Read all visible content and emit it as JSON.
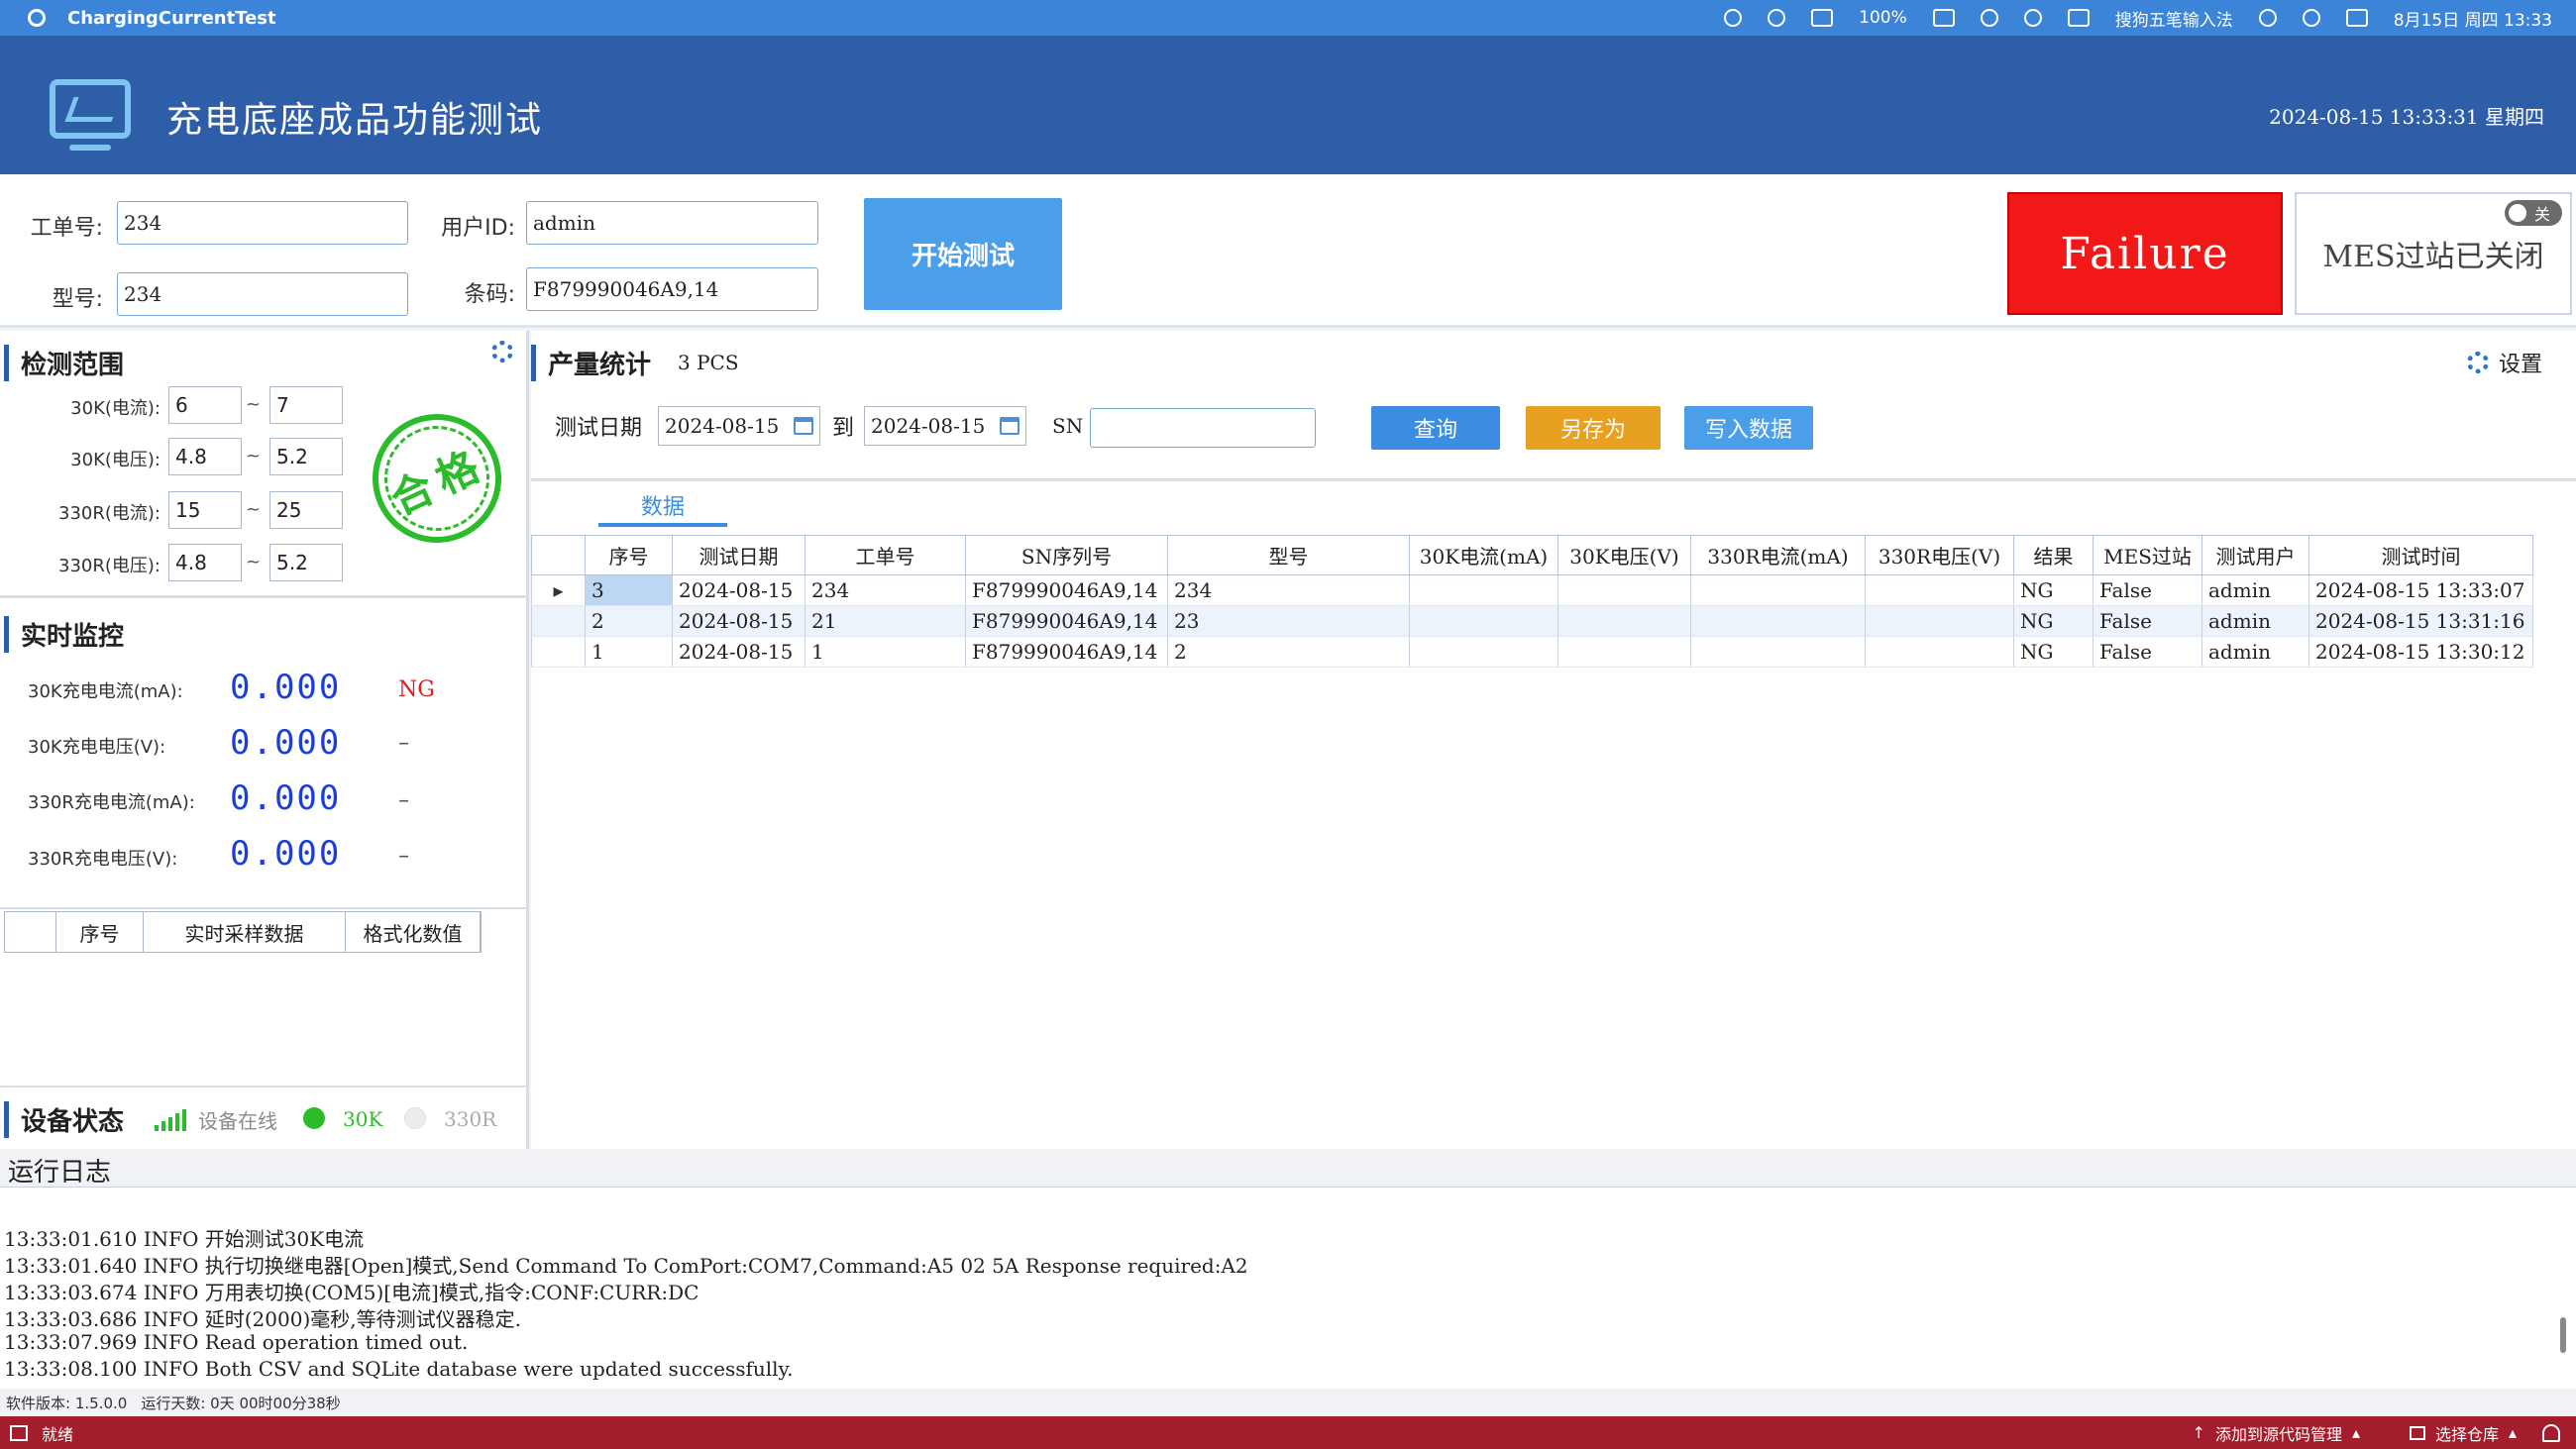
{
  "os": {
    "app_name": "ChargingCurrentTest",
    "battery": "100%",
    "ime": "搜狗五笔输入法",
    "clock": "8月15日 周四 13:33"
  },
  "header": {
    "title": "充电底座成品功能测试",
    "datetime": "2024-08-15 13:33:31 星期四"
  },
  "form": {
    "order_label": "工单号:",
    "order_value": "234",
    "user_label": "用户ID:",
    "user_value": "admin",
    "model_label": "型号:",
    "model_value": "234",
    "barcode_label": "条码:",
    "barcode_value": "F879990046A9,14",
    "start_button": "开始测试",
    "result": "Failure",
    "mes_status": "MES过站已关闭",
    "mes_toggle": "关"
  },
  "range": {
    "title": "检测范围",
    "rows": [
      {
        "label": "30K(电流):",
        "min": "6",
        "max": "7"
      },
      {
        "label": "30K(电压):",
        "min": "4.8",
        "max": "5.2"
      },
      {
        "label": "330R(电流):",
        "min": "15",
        "max": "25"
      },
      {
        "label": "330R(电压):",
        "min": "4.8",
        "max": "5.2"
      }
    ],
    "tilde": "~",
    "stamp_text": "合格"
  },
  "monitor": {
    "title": "实时监控",
    "rows": [
      {
        "label": "30K充电电流(mA):",
        "value": "0.000",
        "status": "NG"
      },
      {
        "label": "30K充电电压(V):",
        "value": "0.000",
        "status": "–"
      },
      {
        "label": "330R充电电流(mA):",
        "value": "0.000",
        "status": "–"
      },
      {
        "label": "330R充电电压(V):",
        "value": "0.000",
        "status": "–"
      }
    ]
  },
  "sample_table": {
    "columns": [
      "序号",
      "实时采样数据",
      "格式化数值"
    ]
  },
  "device": {
    "title": "设备状态",
    "online": "设备在线",
    "dev1": "30K",
    "dev2": "330R",
    "dev1_color": "#2bbb2b",
    "dev2_color": "#e4e4e4"
  },
  "stats": {
    "title": "产量统计",
    "count": "3 PCS",
    "settings": "设置",
    "date_label": "测试日期",
    "date_from": "2024-08-15",
    "to_label": "到",
    "date_to": "2024-08-15",
    "sn_label": "SN",
    "sn_value": "",
    "query_button": "查询",
    "saveas_button": "另存为",
    "write_button": "写入数据",
    "tab": "数据"
  },
  "grid": {
    "columns": [
      "序号",
      "测试日期",
      "工单号",
      "SN序列号",
      "型号",
      "30K电流(mA)",
      "30K电压(V)",
      "330R电流(mA)",
      "330R电压(V)",
      "结果",
      "MES过站",
      "测试用户",
      "测试时间"
    ],
    "rows": [
      [
        "3",
        "2024-08-15",
        "234",
        "F879990046A9,14",
        "234",
        "",
        "",
        "",
        "",
        "NG",
        "False",
        "admin",
        "2024-08-15 13:33:07"
      ],
      [
        "2",
        "2024-08-15",
        "21",
        "F879990046A9,14",
        "23",
        "",
        "",
        "",
        "",
        "NG",
        "False",
        "admin",
        "2024-08-15 13:31:16"
      ],
      [
        "1",
        "2024-08-15",
        "1",
        "F879990046A9,14",
        "2",
        "",
        "",
        "",
        "",
        "NG",
        "False",
        "admin",
        "2024-08-15 13:30:12"
      ]
    ]
  },
  "log": {
    "title": "运行日志",
    "lines": [
      "13:33:01.610  INFO 开始测试30K电流",
      "13:33:01.640  INFO 执行切换继电器[Open]模式,Send Command To ComPort:COM7,Command:A5 02 5A Response required:A2",
      "13:33:03.674  INFO 万用表切换(COM5)[电流]模式,指令:CONF:CURR:DC",
      "13:33:03.686  INFO 延时(2000)毫秒,等待测试仪器稳定.",
      "13:33:07.969  INFO Read operation timed out.",
      "13:33:08.100  INFO Both CSV and SQLite database were updated successfully."
    ]
  },
  "info": {
    "version": "软件版本: 1.5.0.0",
    "runtime": "运行天数: 0天 00时00分38秒"
  },
  "statusbar": {
    "ready": "就绪",
    "add_source": "添加到源代码管理",
    "select_repo": "选择仓库"
  }
}
